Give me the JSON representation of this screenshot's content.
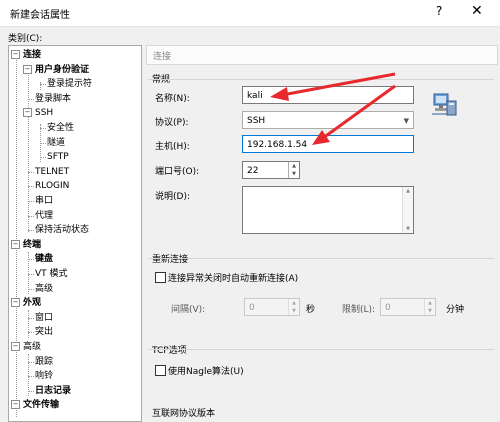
{
  "window": {
    "title": "新建会话属性",
    "help": "?",
    "close": "✕"
  },
  "sidebar": {
    "category_label": "类别(C):",
    "items": [
      {
        "label": "连接",
        "level": 0,
        "expander": "−",
        "bold": true
      },
      {
        "label": "用户身份验证",
        "level": 1,
        "expander": "−",
        "bold": true
      },
      {
        "label": "登录提示符",
        "level": 2,
        "expander": "",
        "bold": false
      },
      {
        "label": "登录脚本",
        "level": 1,
        "expander": "",
        "bold": false
      },
      {
        "label": "SSH",
        "level": 1,
        "expander": "−",
        "bold": false
      },
      {
        "label": "安全性",
        "level": 2,
        "expander": "",
        "bold": false
      },
      {
        "label": "隧道",
        "level": 2,
        "expander": "",
        "bold": false
      },
      {
        "label": "SFTP",
        "level": 2,
        "expander": "",
        "bold": false
      },
      {
        "label": "TELNET",
        "level": 1,
        "expander": "",
        "bold": false
      },
      {
        "label": "RLOGIN",
        "level": 1,
        "expander": "",
        "bold": false
      },
      {
        "label": "串口",
        "level": 1,
        "expander": "",
        "bold": false
      },
      {
        "label": "代理",
        "level": 1,
        "expander": "",
        "bold": false
      },
      {
        "label": "保持活动状态",
        "level": 1,
        "expander": "",
        "bold": false
      },
      {
        "label": "终端",
        "level": 0,
        "expander": "−",
        "bold": true
      },
      {
        "label": "键盘",
        "level": 1,
        "expander": "",
        "bold": true
      },
      {
        "label": "VT 模式",
        "level": 1,
        "expander": "",
        "bold": false
      },
      {
        "label": "高级",
        "level": 1,
        "expander": "",
        "bold": false
      },
      {
        "label": "外观",
        "level": 0,
        "expander": "−",
        "bold": true
      },
      {
        "label": "窗口",
        "level": 1,
        "expander": "",
        "bold": false
      },
      {
        "label": "突出",
        "level": 1,
        "expander": "",
        "bold": false
      },
      {
        "label": "高级",
        "level": 0,
        "expander": "−",
        "bold": false
      },
      {
        "label": "跟踪",
        "level": 1,
        "expander": "",
        "bold": false
      },
      {
        "label": "响铃",
        "level": 1,
        "expander": "",
        "bold": false
      },
      {
        "label": "日志记录",
        "level": 1,
        "expander": "",
        "bold": true
      },
      {
        "label": "文件传输",
        "level": 0,
        "expander": "−",
        "bold": true
      }
    ]
  },
  "main": {
    "breadcrumb": "连接",
    "general": {
      "section_label": "常规",
      "name_label": "名称(N):",
      "name_value": "kali",
      "protocol_label": "协议(P):",
      "protocol_value": "SSH",
      "host_label": "主机(H):",
      "host_value": "192.168.1.54",
      "port_label": "端口号(O):",
      "port_value": "22",
      "desc_label": "说明(D):",
      "desc_value": ""
    },
    "reconnect": {
      "section_label": "重新连接",
      "checkbox_label": "连接异常关闭时自动重新连接(A)",
      "interval_label": "间隔(V):",
      "interval_value": "0",
      "interval_unit": "秒",
      "limit_label": "限制(L):",
      "limit_value": "0",
      "limit_unit": "分钟"
    },
    "tcp": {
      "section_label": "TCP选项",
      "checkbox_label": "使用Nagle算法(U)"
    },
    "ipv_section_label": "互联网协议版本"
  },
  "colors": {
    "annotation_arrow": "#e8282c",
    "accent": "#0078d7"
  }
}
